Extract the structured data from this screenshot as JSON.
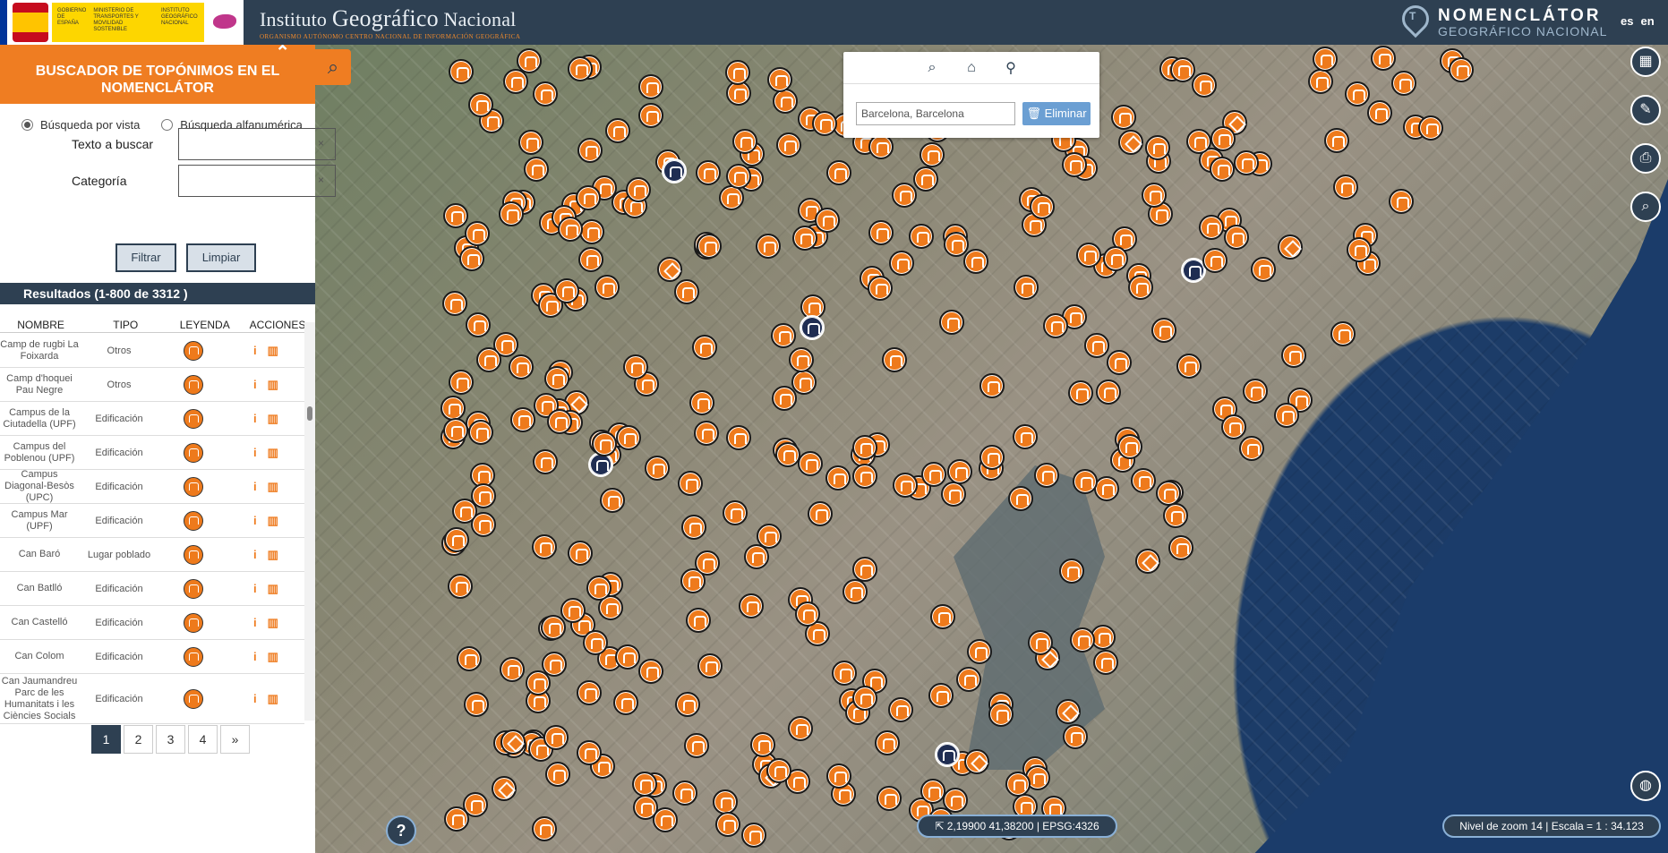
{
  "header": {
    "gov_text": "GOBIERNO DE ESPAÑA",
    "ministry_text": "MINISTERIO DE TRANSPORTES Y MOVILIDAD SOSTENIBLE",
    "ign_small": "INSTITUTO GEOGRÁFICO NACIONAL",
    "title_a": "Instituto ",
    "title_b": "Geográfico",
    "title_c": " Nacional",
    "subtitle": "ORGANISMO AUTÓNOMO   CENTRO NACIONAL DE INFORMACIÓN GEOGRÁFICA",
    "app_name": "NOMENCLÁTOR",
    "app_sub": "GEOGRÁFICO NACIONAL",
    "lang_es": "es",
    "lang_en": "en"
  },
  "panel": {
    "title": "BUSCADOR DE TOPÓNIMOS EN EL NOMENCLÁTOR",
    "mode_view": "Búsqueda por vista",
    "mode_alpha": "Búsqueda alfanumérica",
    "text_label": "Texto a buscar",
    "category_label": "Categoría",
    "clear_x": "×",
    "filter_btn": "Filtrar",
    "clear_btn": "Limpiar",
    "results": "Resultados (1-800 de 3312 )",
    "columns": [
      "NOMBRE",
      "TIPO",
      "LEYENDA",
      "ACCIONES"
    ],
    "rows": [
      {
        "name": "Camp de rugbi La Foixarda",
        "type": "Otros"
      },
      {
        "name": "Camp d'hoquei Pau Negre",
        "type": "Otros"
      },
      {
        "name": "Campus de la Ciutadella (UPF)",
        "type": "Edificación"
      },
      {
        "name": "Campus del Poblenou (UPF)",
        "type": "Edificación"
      },
      {
        "name": "Campus Diagonal-Besòs (UPC)",
        "type": "Edificación"
      },
      {
        "name": "Campus Mar (UPF)",
        "type": "Edificación"
      },
      {
        "name": "Can Baró",
        "type": "Lugar poblado"
      },
      {
        "name": "Can Batlló",
        "type": "Edificación"
      },
      {
        "name": "Can Castelló",
        "type": "Edificación"
      },
      {
        "name": "Can Colom",
        "type": "Edificación"
      },
      {
        "name": "Can Jaumandreu Parc de les Humanitats i les Ciències Socials",
        "type": "Edificación"
      }
    ],
    "pages": [
      "1",
      "2",
      "3",
      "4",
      "»"
    ]
  },
  "map": {
    "place_value": "Barcelona, Barcelona",
    "delete_label": "Eliminar",
    "coords": "2,19900   41,38200 | EPSG:4326",
    "zoom_scale": "Nivel de zoom 14 | Escala = 1 : 34.123",
    "help": "?"
  },
  "colors": {
    "accent": "#ef7d22",
    "navy": "#2e4052"
  }
}
